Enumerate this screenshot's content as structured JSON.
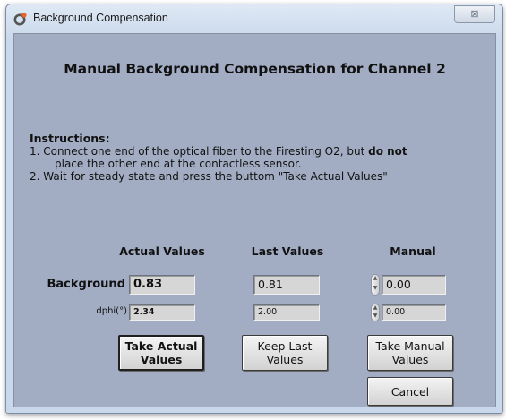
{
  "window": {
    "title": "Background Compensation",
    "close_glyph": "⊠"
  },
  "heading": "Manual Background Compensation for Channel  2",
  "instructions": {
    "title": "Instructions:",
    "line1_pre": "1. Connect one end of the optical fiber to the Firesting O2, but ",
    "line1_bold": "do not",
    "line1_cont": "place the other end at the contactless sensor.",
    "line2": "2. Wait for steady state and press the buttom \"Take Actual Values\""
  },
  "columns": {
    "actual": "Actual Values",
    "last": "Last Values",
    "manual": "Manual"
  },
  "rows": {
    "background_label": "Background",
    "dphi_label": "dphi(°)"
  },
  "values": {
    "actual_background": "0.83",
    "actual_dphi": "2.34",
    "last_background": "0.81",
    "last_dphi": "2.00",
    "manual_background": "0.00",
    "manual_dphi": "0.00"
  },
  "buttons": {
    "take_actual": "Take Actual Values",
    "keep_last": "Keep Last Values",
    "take_manual": "Take Manual Values",
    "cancel": "Cancel"
  },
  "icons": {
    "app": "app-logo-icon",
    "close": "close-icon",
    "spinner_up": "▲",
    "spinner_down": "▼"
  },
  "colors": {
    "panel_bg": "#a2adc3",
    "field_bg": "#d6d6d6",
    "logo_orange": "#e8642a",
    "logo_gray": "#555555"
  }
}
